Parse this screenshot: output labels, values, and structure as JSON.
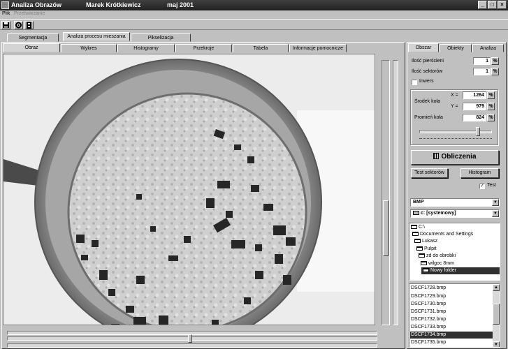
{
  "window": {
    "app_title": "Analiza Obrazów",
    "author": "Marek Krótkiewicz",
    "date": "maj 2001",
    "buttons": {
      "minimize": "_",
      "maximize": "□",
      "close": "×"
    }
  },
  "menu": {
    "file": "Plik",
    "processing": "Przetwarzanie"
  },
  "toolbar": {
    "icons": [
      "disk-icon",
      "gear-icon",
      "film-icon"
    ]
  },
  "main_tabs": [
    "Segmentacja",
    "Analiza procesu mieszania",
    "Pikselizacja"
  ],
  "sub_tabs": [
    "Obraz",
    "Wykres",
    "Histogramy",
    "Przekroje",
    "Tabela",
    "Informacje pomocnicze"
  ],
  "right_tabs": [
    "Obszar",
    "Obiekty",
    "Analiza"
  ],
  "params": {
    "rings_label": "Ilość pierścieni",
    "rings_value": "1",
    "sectors_label": "Ilość sektorów",
    "sectors_value": "1",
    "inverse_label": "Inwers",
    "center_label": "Środek koła",
    "x_label": "X =",
    "x_value": "1264",
    "y_label": "Y =",
    "y_value": "979",
    "radius_label": "Promień koła",
    "radius_value": "824",
    "spin_glyph": "%"
  },
  "buttons": {
    "compute": "Obliczenia",
    "test_sectors": "Test sektorów",
    "histogram": "Histogram",
    "test": "Test",
    "check_mark": "✓"
  },
  "file_browser": {
    "format": "BMP",
    "drive": "c: [systemowy]",
    "tree": [
      "C:\\",
      "Documents and Settings",
      "Lukasz",
      "Pulpit",
      "zd do obrobki",
      "wilgoc 8mm",
      "Nowy folder"
    ],
    "files": [
      "DSCF1728.bmp",
      "DSCF1729.bmp",
      "DSCF1730.bmp",
      "DSCF1731.bmp",
      "DSCF1732.bmp",
      "DSCF1733.bmp",
      "DSCF1734.bmp",
      "DSCF1735.bmp"
    ],
    "selected_file": "DSCF1734.bmp"
  },
  "colors": {
    "titlebar": "#303030",
    "face": "#c0c0c0",
    "selection": "#303030"
  }
}
